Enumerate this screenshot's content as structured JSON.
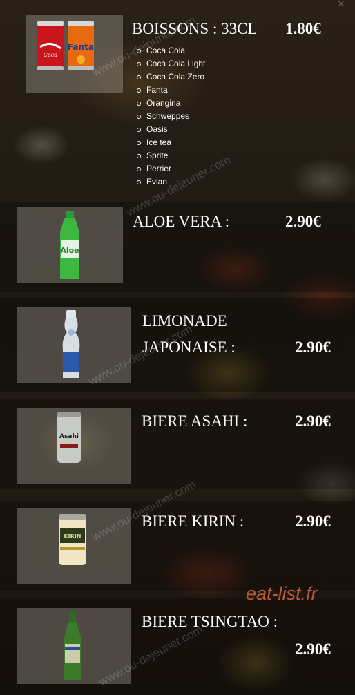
{
  "boissons": {
    "title": "BOISSONS : 33CL",
    "price": "1.80€",
    "items": [
      "Coca Cola",
      "Coca Cola Light",
      "Coca Cola Zero",
      "Fanta",
      "Orangina",
      "Schweppes",
      "Oasis",
      "Ice tea",
      "Sprite",
      "Perrier",
      "Evian"
    ]
  },
  "aloe": {
    "title": "ALOE VERA :",
    "price": "2.90€"
  },
  "limonade": {
    "line1": "LIMONADE",
    "line2": "JAPONAISE :",
    "price": "2.90€"
  },
  "asahi": {
    "title": "BIERE ASAHI :",
    "price": "2.90€"
  },
  "kirin": {
    "title": "BIERE KIRIN :",
    "price": "2.90€"
  },
  "tsingtao": {
    "title": "BIERE TSINGTAO :",
    "price": "2.90€"
  },
  "watermarks": {
    "site": "www.ou-dejeuner.com",
    "brand": "eat-list.fr"
  },
  "colors": {
    "text": "#ffffff",
    "brand_watermark": "#b85a3a"
  },
  "icons": {
    "close": "close-icon"
  }
}
